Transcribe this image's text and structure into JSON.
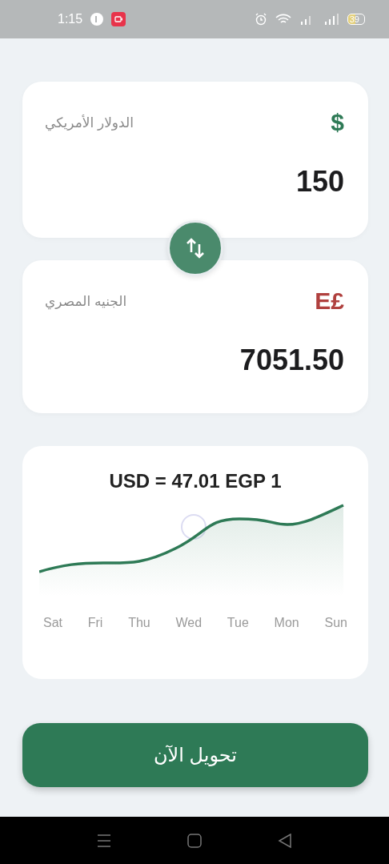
{
  "status_bar": {
    "time": "1:15",
    "battery": "39"
  },
  "currencies": [
    {
      "name": "الدولار الأمريكي",
      "symbol": "$",
      "color": "#2e7a56",
      "amount": "150"
    },
    {
      "name": "الجنيه المصري",
      "symbol": "E£",
      "color": "#b0403e",
      "amount": "7051.50"
    }
  ],
  "rate_card": {
    "title": "USD = 47.01 EGP 1",
    "days": [
      "Sat",
      "Fri",
      "Thu",
      "Wed",
      "Tue",
      "Mon",
      "Sun"
    ]
  },
  "convert_button": "تحويل الآن"
}
